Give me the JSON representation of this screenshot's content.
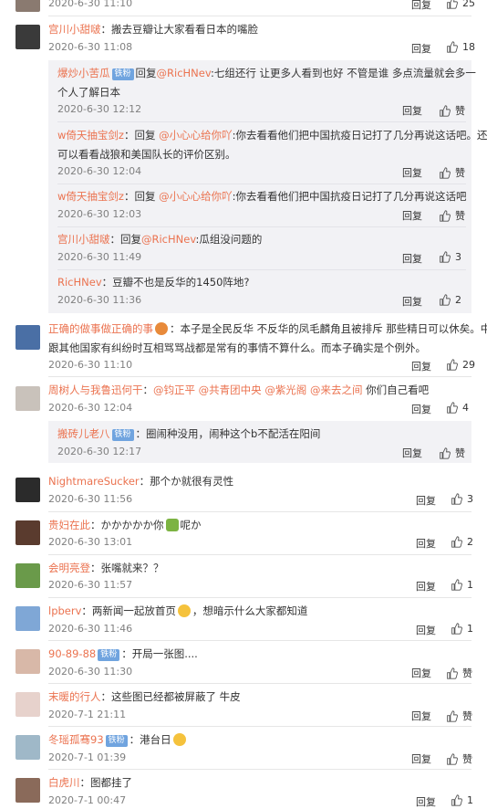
{
  "labels": {
    "reply": "回复",
    "like": "赞",
    "reply_to": "回复"
  },
  "comments": [
    {
      "time": "2020-6-30 11:10",
      "likes": "25"
    },
    {
      "user": "宫川小甜啵",
      "sep": "：",
      "text": "搬去豆瓣让大家看看日本的嘴脸",
      "time": "2020-6-30 11:08",
      "likes": "18"
    },
    {
      "user": "爆炒小苦瓜",
      "badge": "铁粉",
      "at": "@RicHNev",
      "line1": ":七组还行 让更多人看到也好 不管是谁 多点流量就会多一",
      "line2": "个人了解日本",
      "time": "2020-6-30 12:12",
      "likes": "赞"
    },
    {
      "user": "w倚天抽宝剑z",
      "sep": "：回复",
      "at": "@小心心给你吖",
      "line1": ":你去看看他们把中国抗疫日记打了几分再说这话吧。还",
      "line2": "可以看看战狼和美国队长的评价区别。",
      "time": "2020-6-30 12:04",
      "likes": "赞"
    },
    {
      "user": "w倚天抽宝剑z",
      "sep": "：回复",
      "at": "@小心心给你吖",
      "text": ":你去看看他们把中国抗疫日记打了几分再说这话吧",
      "time": "2020-6-30 12:03",
      "likes": "赞"
    },
    {
      "user": "宫川小甜啵",
      "sep": "：回复",
      "at": "@RicHNev",
      "text": ":瓜组没问题的",
      "time": "2020-6-30 11:49",
      "likes": "3"
    },
    {
      "user": "RicHNev",
      "sep": "：",
      "text": "豆瓣不也是反华的1450阵地?",
      "time": "2020-6-30 11:36",
      "likes": "2"
    },
    {
      "user": "正确的做事做正确的事",
      "line1": "：本子是全民反华 不反华的凤毛麟角且被排斥 那些精日可以休矣。中国",
      "line2": "跟其他国家有纠纷时互相骂骂战都是常有的事情不算什么。而本子确实是个例外。",
      "time": "2020-6-30 11:10",
      "likes": "29"
    },
    {
      "user": "周树人与我鲁迅何干",
      "sep": "：",
      "ats": [
        "@钧正平",
        "@共青团中央",
        "@紫光阁",
        "@来去之间"
      ],
      "text": " 你们自己看吧",
      "time": "2020-6-30 12:04",
      "likes": "4"
    },
    {
      "user": "搬砖儿老八",
      "badge": "铁粉",
      "text": "：圈闹种没用，闹种这个b不配活在阳间",
      "time": "2020-6-30 12:17",
      "likes": "赞"
    },
    {
      "user": "NightmareSucker",
      "sep": "：",
      "text": "那个か就很有灵性",
      "time": "2020-6-30 11:56",
      "likes": "3"
    },
    {
      "user": "贵妇在此",
      "sep": "：",
      "text": "かかかかか你",
      "text2": "呢か",
      "time": "2020-6-30 13:01",
      "likes": "2"
    },
    {
      "user": "会明亮登",
      "sep": "：",
      "text": "张嘴就来？？",
      "time": "2020-6-30 11:57",
      "likes": "1"
    },
    {
      "user": "lpberv",
      "sep": "：",
      "text": "两新闻一起放首页",
      "text2": "，想暗示什么大家都知道",
      "time": "2020-6-30 11:46",
      "likes": "1"
    },
    {
      "user": "90-89-88",
      "badge": "铁粉",
      "text": "：开局一张图....",
      "time": "2020-6-30 11:30",
      "likes": "赞"
    },
    {
      "user": "末暖的行人",
      "sep": "：",
      "text": "这些图已经都被屏蔽了 牛皮",
      "time": "2020-7-1 21:11",
      "likes": "赞"
    },
    {
      "user": "冬瑶孤骞93",
      "badge": "铁粉",
      "text": "：港台日",
      "time": "2020-7-1 01:39",
      "likes": "赞"
    },
    {
      "user": "白虎川",
      "sep": "：",
      "text": "图都挂了",
      "time": "2020-7-1 00:47",
      "likes": "1"
    }
  ],
  "colors": {
    "username": "#eb7350",
    "badge": "#70a4df",
    "time": "#808080",
    "sub_bg": "#f2f2f5"
  },
  "icons": {
    "like": "thumb-up-icon"
  }
}
